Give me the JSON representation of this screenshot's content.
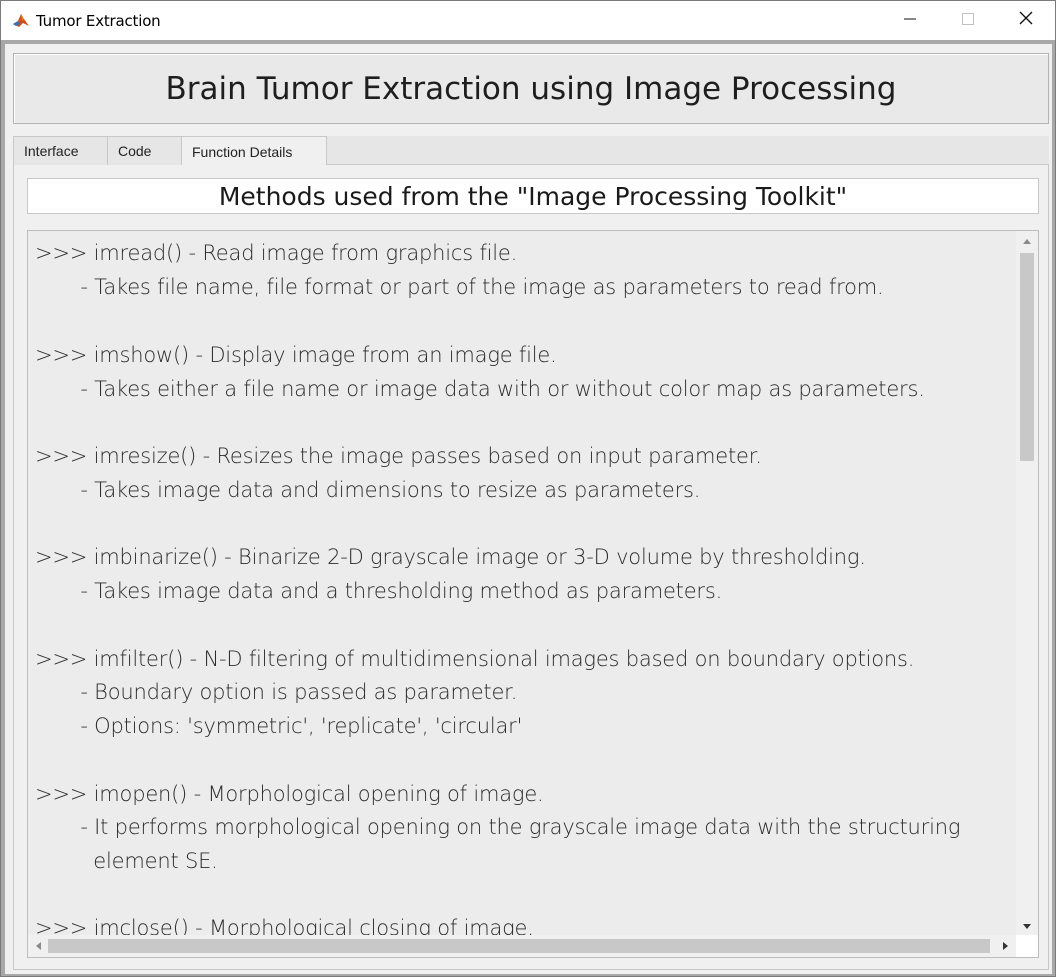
{
  "window": {
    "title": "Tumor Extraction",
    "icon": "matlab-icon",
    "controls": [
      "minimize-icon",
      "maximize-icon",
      "close-icon"
    ]
  },
  "header": {
    "title": "Brain Tumor Extraction using Image Processing"
  },
  "tabs": [
    {
      "label": "Interface",
      "active": false
    },
    {
      "label": "Code",
      "active": false
    },
    {
      "label": "Function Details",
      "active": true
    }
  ],
  "details": {
    "heading": "Methods used from the \"Image Processing Toolkit\"",
    "lines": [
      ">>> imread() - Read image from graphics file.",
      "       - Takes file name, file format or part of the image as parameters to read from.",
      ">>> imshow() - Display image from an image file.",
      "       - Takes either a file name or image data with or without color map as parameters.",
      ">>> imresize() - Resizes the image passes based on input parameter.",
      "       - Takes image data and dimensions to resize as parameters.",
      ">>> imbinarize() - Binarize 2-D grayscale image or 3-D volume by thresholding.",
      "       - Takes image data and a thresholding method as parameters.",
      ">>> imfilter() - N-D filtering of multidimensional images based on boundary options.",
      "       - Boundary option is passed as parameter.",
      "       - Options: 'symmetric', 'replicate', 'circular'",
      ">>> imopen() - Morphological opening of image.",
      "       - It performs morphological opening on the grayscale image data with the structuring",
      "         element SE.",
      ">>> imclose() - Morphological closing of image."
    ]
  },
  "colors": {
    "window_bg": "#f0f0f0",
    "text": "#2b2b2b",
    "border": "#c8c8c8"
  }
}
